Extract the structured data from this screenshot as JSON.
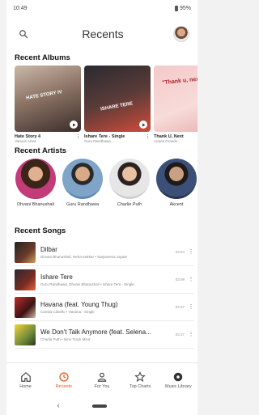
{
  "status": {
    "time": "10:49",
    "battery": "95%"
  },
  "header": {
    "title": "Recents"
  },
  "albums_section": {
    "title": "Recent Albums",
    "items": [
      {
        "name": "Hate Story 4",
        "sub": "Various Artist",
        "art_text": "HATE STORY IV"
      },
      {
        "name": "Ishare Tere - Single",
        "sub": "Guru Randhawa",
        "art_text": "ISHARE TERE"
      },
      {
        "name": "Thank U, Next",
        "sub": "Ariana Grande",
        "art_text": "\"Thank u, next\""
      }
    ]
  },
  "artists_section": {
    "title": "Recent Artists",
    "items": [
      {
        "name": "Dhvani Bhanushali"
      },
      {
        "name": "Guru Randhawa"
      },
      {
        "name": "Charlie Puth"
      },
      {
        "name": "Akcent"
      }
    ]
  },
  "songs_section": {
    "title": "Recent Songs",
    "items": [
      {
        "title": "Dilbar",
        "sub": "Dhvani Bhanushali, Neha Kakkar • Satyameva Jayate",
        "duration": "03:04"
      },
      {
        "title": "Ishare Tere",
        "sub": "Guru Randhawa, Dhvani Bhanushali • Ishare Tere - Single",
        "duration": "03:09"
      },
      {
        "title": "Havana (feat. Young Thug)",
        "sub": "Camila Cabello • Havana - Single",
        "duration": "03:37"
      },
      {
        "title": "We Don't Talk Anymore (feat. Selena...",
        "sub": "Charlie Puth • Nine Track Mind",
        "duration": "03:37"
      }
    ]
  },
  "bottom_nav": {
    "items": [
      {
        "label": "Home",
        "icon": "home-icon"
      },
      {
        "label": "Recents",
        "icon": "history-icon"
      },
      {
        "label": "For You",
        "icon": "person-icon"
      },
      {
        "label": "Top Charts",
        "icon": "star-icon"
      },
      {
        "label": "Music Library",
        "icon": "library-icon"
      }
    ]
  },
  "colors": {
    "accent": "#e25a1c"
  }
}
